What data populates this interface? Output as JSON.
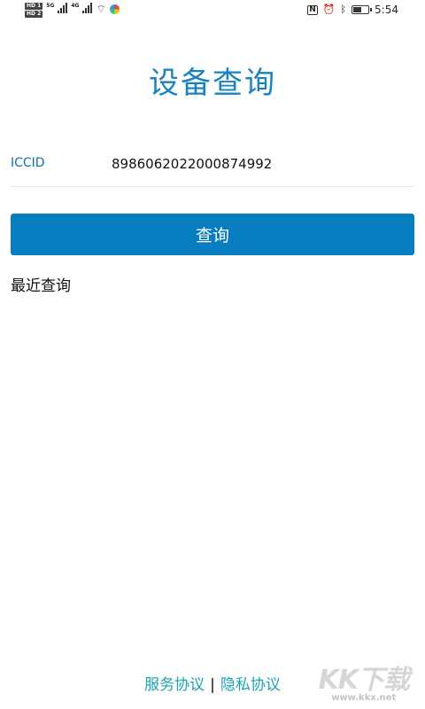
{
  "status_bar": {
    "hd_top": "HD 1",
    "hd_bottom": "HD 2",
    "net_1": "5G",
    "net_2": "4G",
    "time": "5:54",
    "battery_level": 0.6
  },
  "page": {
    "title": "设备查询"
  },
  "form": {
    "iccid_label": "ICCID",
    "iccid_value": "8986062022000874992",
    "query_button": "查询"
  },
  "recent": {
    "heading": "最近查询"
  },
  "footer": {
    "service_agreement": "服务协议",
    "separator": "|",
    "privacy_agreement": "隐私协议"
  },
  "watermark": {
    "logo": "KK下载",
    "url": "www.kkx.net"
  }
}
